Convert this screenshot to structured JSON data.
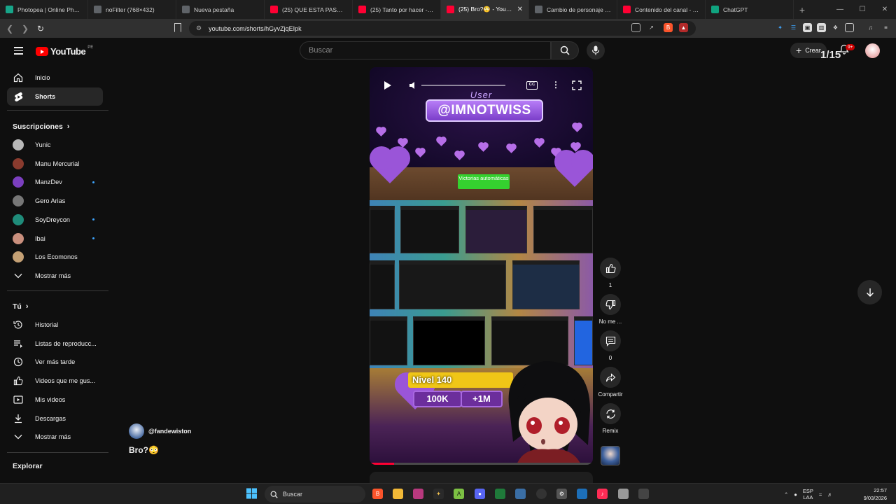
{
  "browser": {
    "tabs": [
      {
        "label": "Photopea | Online Photo E",
        "color": "#17a589"
      },
      {
        "label": "noFilter (768×432)",
        "color": "#5f6368"
      },
      {
        "label": "Nueva pestaña",
        "color": "#5f6368"
      },
      {
        "label": "(25) QUE ESTA PASANDO",
        "color": "#ff0033"
      },
      {
        "label": "(25) Tanto por hacer - You",
        "color": "#ff0033"
      },
      {
        "label": "(25) Bro?😳 - YouTube",
        "color": "#ff0033"
      },
      {
        "label": "Cambio de personaje VFX",
        "color": "#5f6368"
      },
      {
        "label": "Contenido del canal - You",
        "color": "#ff0033"
      },
      {
        "label": "ChatGPT",
        "color": "#10a37f"
      }
    ],
    "active_tab": 5,
    "url": "youtube.com/shorts/hGyvZjqEIpk"
  },
  "youtube": {
    "logo_text": "YouTube",
    "country_code": "PE",
    "search_placeholder": "Buscar",
    "create_label": "Crear",
    "shorts_pager": "1/15",
    "notif_badge": "9+"
  },
  "sidebar": {
    "main": [
      {
        "label": "Inicio",
        "icon": "home-icon"
      },
      {
        "label": "Shorts",
        "icon": "shorts-icon",
        "selected": true
      }
    ],
    "subs_header": "Suscripciones",
    "subscriptions": [
      {
        "label": "Yunic",
        "color": "#b8b8b8",
        "dot": false
      },
      {
        "label": "Manu Mercurial",
        "color": "#8a3b2e",
        "dot": false
      },
      {
        "label": "ManzDev",
        "color": "#7b3fbf",
        "dot": true
      },
      {
        "label": "Gero Arias",
        "color": "#777777",
        "dot": false
      },
      {
        "label": "SoyDreycon",
        "color": "#1f8c7a",
        "dot": true
      },
      {
        "label": "Ibai",
        "color": "#c98f7d",
        "dot": true
      },
      {
        "label": "Los Ecomonos",
        "color": "#c4a074",
        "dot": false
      }
    ],
    "subs_more": "Mostrar más",
    "you_header": "Tú",
    "you_items": [
      {
        "label": "Historial",
        "icon": "history-icon"
      },
      {
        "label": "Listas de reproducc...",
        "icon": "playlist-icon"
      },
      {
        "label": "Ver más tarde",
        "icon": "clock-icon"
      },
      {
        "label": "Videos que me gus...",
        "icon": "like-icon"
      },
      {
        "label": "Mis videos",
        "icon": "my-videos-icon"
      },
      {
        "label": "Descargas",
        "icon": "download-icon"
      },
      {
        "label": "Mostrar más",
        "icon": "chevron-down-icon"
      }
    ],
    "explore_header": "Explorar"
  },
  "short": {
    "overlay_user_label": "User",
    "overlay_handle": "@IMNOTWISS",
    "overlay_victory": "Victorias automáticas",
    "overlay_level": "Nivel 140",
    "overlay_pill_1": "100K",
    "overlay_pill_2": "+1M",
    "channel": "@fandewiston",
    "title": "Bro?😳",
    "progress": 0.11,
    "likes": "1",
    "dislike_label": "No me ...",
    "comments": "0",
    "share_label": "Compartir",
    "remix_label": "Remix"
  },
  "taskbar": {
    "search_label": "Buscar",
    "lang_top": "ESP",
    "lang_bottom": "LAA",
    "time": "22:57",
    "date": "9/03/2026"
  }
}
